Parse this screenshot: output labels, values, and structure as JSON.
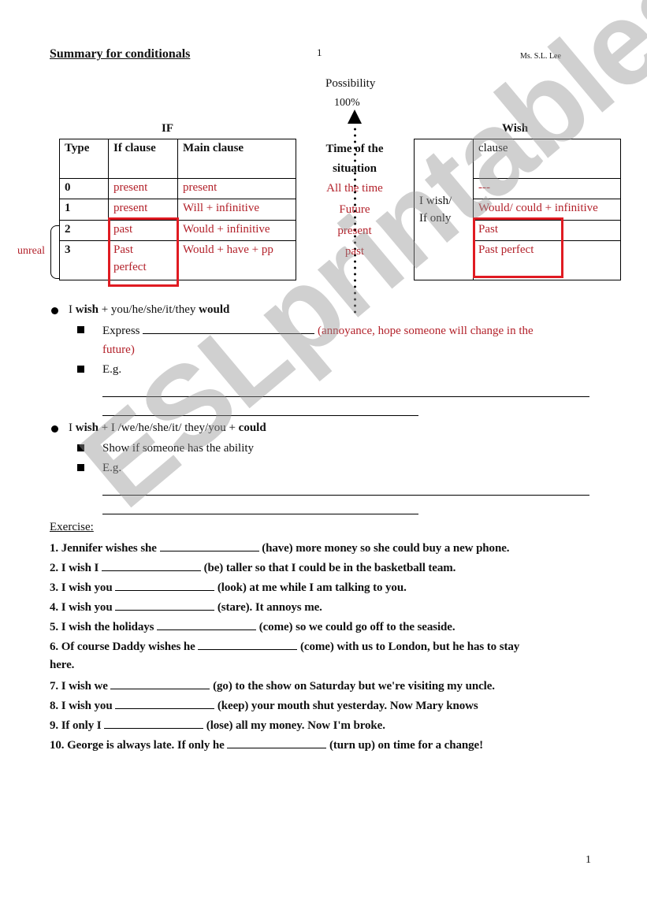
{
  "header": {
    "title": "Summary for conditionals",
    "page_top": "1",
    "author": "Ms. S.L. Lee"
  },
  "possibility": {
    "label": "Possibility",
    "percent": "100%"
  },
  "if_table": {
    "label": "IF",
    "headers": [
      "Type",
      "If clause",
      "Main clause"
    ],
    "rows": [
      {
        "type": "0",
        "if_clause": "present",
        "main_clause": "present"
      },
      {
        "type": "1",
        "if_clause": "present",
        "main_clause": "Will + infinitive"
      },
      {
        "type": "2",
        "if_clause": "past",
        "main_clause": "Would + infinitive"
      },
      {
        "type": "3",
        "if_clause_line1": "Past",
        "if_clause_line2": "perfect",
        "main_clause": "Would + have + pp"
      }
    ],
    "unreal_label": "unreal"
  },
  "time_column": {
    "header_line1": "Time of the",
    "header_line2": "situation",
    "values": [
      "All the time",
      "Future",
      "present",
      "past"
    ]
  },
  "wish_table": {
    "label": "Wish",
    "left_line1": "I wish/",
    "left_line2": "If only",
    "header": "clause",
    "rows": [
      "---",
      "Would/ could + infinitive",
      "Past",
      "Past perfect"
    ]
  },
  "section_would": {
    "bullet_pre": "I ",
    "bullet_bold1": "wish",
    "bullet_mid": " + you/he/she/it/they ",
    "bullet_bold2": "would",
    "sub1_label": "Express",
    "sub1_note_line1": "(annoyance, hope someone will change in the",
    "sub1_note_line2": "future)",
    "sub2_label": "E.g."
  },
  "section_could": {
    "bullet_pre": "I ",
    "bullet_bold1": "wish",
    "bullet_mid": " + I /we/he/she/it/ they/you + ",
    "bullet_bold2": "could",
    "sub1_label": "Show if someone has the ability",
    "sub2_label": "E.g."
  },
  "exercise": {
    "heading": "Exercise:",
    "items": [
      {
        "pre": "1. Jennifer wishes she",
        "post": "(have) more money so she could buy a new phone."
      },
      {
        "pre": "2. I wish I",
        "post": "(be) taller so that I could be in the basketball team."
      },
      {
        "pre": "3. I wish you",
        "post": "(look) at me while I am talking to you."
      },
      {
        "pre": "4. I wish you",
        "post": "(stare). It annoys me."
      },
      {
        "pre": "5. I wish the holidays",
        "post": "(come) so we could go off to the seaside."
      },
      {
        "pre": "6. Of course Daddy wishes he",
        "post": "(come) with us to London, but he has to stay",
        "post2": "here."
      },
      {
        "pre": "7. I wish we",
        "post": "(go) to the show on Saturday but we're visiting my uncle."
      },
      {
        "pre": "8. I wish you",
        "post": "(keep) your mouth shut yesterday. Now Mary knows"
      },
      {
        "pre": "9. If only I",
        "post": "(lose) all my money. Now I'm broke."
      },
      {
        "pre": "10. George is always late. If only he",
        "post": "(turn up) on time for a change!"
      }
    ]
  },
  "footer": {
    "page_number": "1"
  },
  "watermark": {
    "text": "ESLprintables.com"
  },
  "colors": {
    "answer_red": "#b3222b",
    "highlight_box": "#e01b22"
  }
}
